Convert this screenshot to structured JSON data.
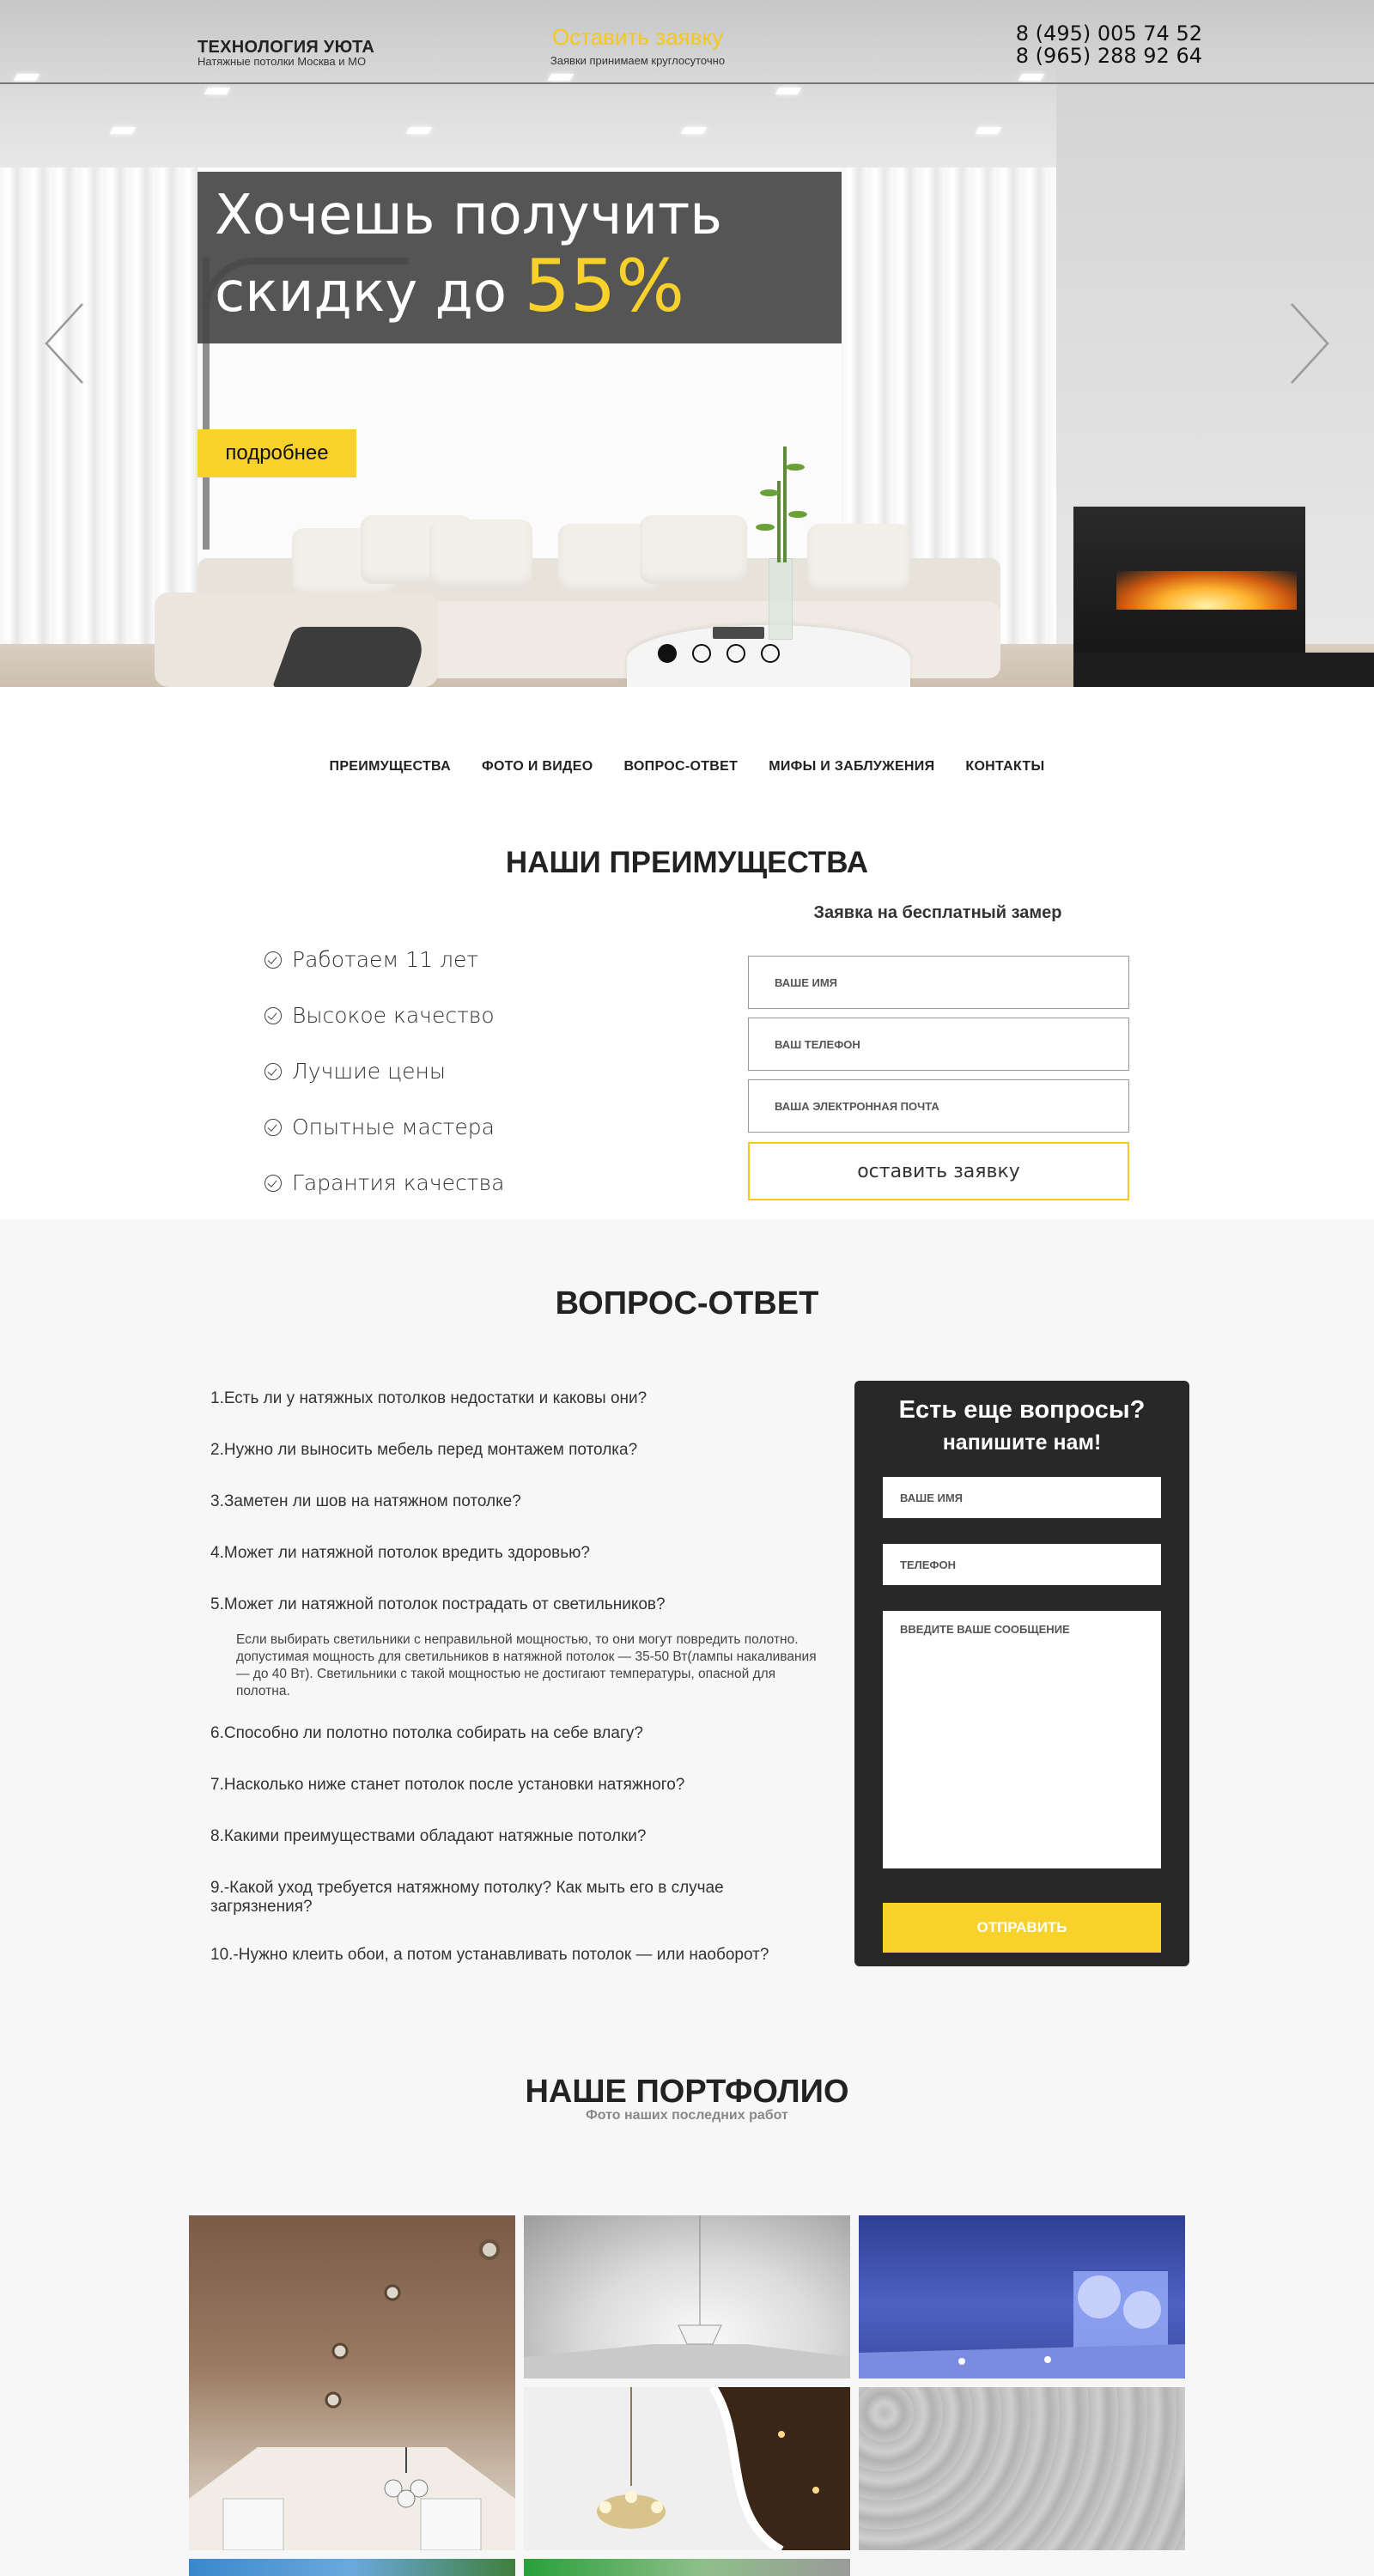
{
  "header": {
    "logo_title": "ТЕХНОЛОГИЯ УЮТА",
    "logo_subtitle": "Натяжные потолки Москва и МО",
    "order_link": "Оставить заявку",
    "order_subtitle": "Заявки принимаем круглосуточно",
    "phones": [
      "8 (495) 005 74 52",
      "8 (965) 288 92 64"
    ]
  },
  "hero": {
    "offer_line1": "Хочешь получить",
    "offer_line2": "скидку до ",
    "offer_accent": "55%",
    "more_button": "подробнее",
    "slides_count": 4,
    "active_slide": 1
  },
  "nav": {
    "items": [
      "ПРЕИМУЩЕСТВА",
      "ФОТО И ВИДЕО",
      "ВОПРОС-ОТВЕТ",
      "МИФЫ И ЗАБЛУЖЕНИЯ",
      "КОНТАКТЫ"
    ]
  },
  "advantages": {
    "title": "НАШИ ПРЕИМУЩЕСТВА",
    "items": [
      "Работаем 11 лет",
      "Высокое качество",
      "Лучшие цены",
      "Опытные мастера",
      "Гарантия качества"
    ]
  },
  "measure_form": {
    "title": "Заявка на бесплатный замер",
    "name_placeholder": "ВАШЕ ИМЯ",
    "phone_placeholder": "ВАШ ТЕЛЕФОН",
    "email_placeholder": "ВАША ЭЛЕКТРОННАЯ ПОЧТА",
    "submit": "оставить заявку"
  },
  "faq": {
    "title": "ВОПРОС-ОТВЕТ",
    "questions": [
      "1.Есть ли у натяжных потолков недостатки и каковы они?",
      "2.Нужно ли выносить мебель перед монтажем потолка?",
      "3.Заметен ли шов на натяжном потолке?",
      "4.Может ли натяжной потолок вредить здоровью?",
      "5.Может ли натяжной потолок пострадать от светильников?",
      "6.Способно ли полотно потолка собирать на себе влагу?",
      "7.Насколько ниже станет потолок после установки натяжного?",
      "8.Какими преимуществами обладают натяжные потолки?",
      "9.-Какой уход требуется натяжному потолку? Как мыть его в случае загрязнения?",
      "10.-Нужно клеить обои, а потом устанавливать потолок — или наоборот?"
    ],
    "expanded_answer": "Если выбирать светильники с неправильной мощностью, то они могут повредить полотно. допустимая мощность для светильников в натяжной потолок — 35-50 Вт(лампы накаливания — до 40 Вт). Светильники с такой мощностью не достигают температуры, опасной для полотна."
  },
  "question_box": {
    "title": "Есть еще вопросы?",
    "subtitle": "напишите нам!",
    "name_placeholder": "ВАШЕ ИМЯ",
    "phone_placeholder": "ТЕЛЕФОН",
    "message_placeholder": "ВВЕДИТЕ ВАШЕ СООБЩЕНИЕ",
    "submit": "ОТПРАВИТЬ"
  },
  "portfolio": {
    "title": "НАШЕ ПОРТФОЛИО",
    "subtitle": "Фото наших последних работ"
  },
  "colors": {
    "accent": "#f8d12a",
    "dark": "#282828",
    "text": "#222222"
  }
}
